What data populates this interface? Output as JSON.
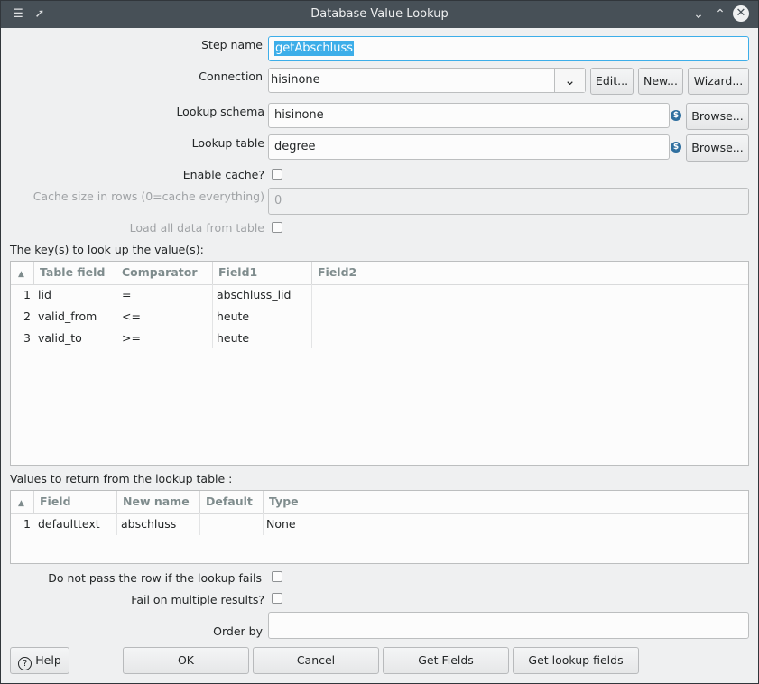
{
  "window": {
    "title": "Database Value Lookup",
    "app_icon": "database-icon",
    "pin_icon": "pin-icon"
  },
  "form": {
    "step_name_label": "Step name",
    "step_name_value": "getAbschluss",
    "connection_label": "Connection",
    "connection_value": "hisinone",
    "edit_label": "Edit...",
    "new_label": "New...",
    "wizard_label": "Wizard...",
    "schema_label": "Lookup schema",
    "schema_value": "hisinone",
    "table_label": "Lookup table",
    "table_value": "degree",
    "browse_label": "Browse...",
    "variable_icon_glyph": "$",
    "enable_cache_label": "Enable cache?",
    "cache_size_label": "Cache size in rows (0=cache everything)",
    "cache_size_value": "0",
    "load_all_label": "Load all data from table"
  },
  "keys": {
    "section_label": "The key(s) to look up the value(s):",
    "columns": [
      "Table field",
      "Comparator",
      "Field1",
      "Field2"
    ],
    "rows": [
      {
        "num": "1",
        "table_field": "lid",
        "comparator": "=",
        "field1": "abschluss_lid",
        "field2": ""
      },
      {
        "num": "2",
        "table_field": "valid_from",
        "comparator": "<=",
        "field1": "heute",
        "field2": ""
      },
      {
        "num": "3",
        "table_field": "valid_to",
        "comparator": ">=",
        "field1": "heute",
        "field2": ""
      }
    ]
  },
  "values": {
    "section_label": "Values to return from the lookup table :",
    "columns": [
      "Field",
      "New name",
      "Default",
      "Type"
    ],
    "rows": [
      {
        "num": "1",
        "field": "defaulttext",
        "new_name": "abschluss",
        "default": "",
        "type": "None"
      }
    ]
  },
  "options": {
    "no_pass_label": "Do not pass the row if the lookup fails",
    "fail_multi_label": "Fail on multiple results?",
    "order_by_label": "Order by",
    "order_by_value": ""
  },
  "buttons": {
    "help": "Help",
    "ok": "OK",
    "cancel": "Cancel",
    "get_fields": "Get Fields",
    "get_lookup_fields": "Get lookup fields"
  }
}
